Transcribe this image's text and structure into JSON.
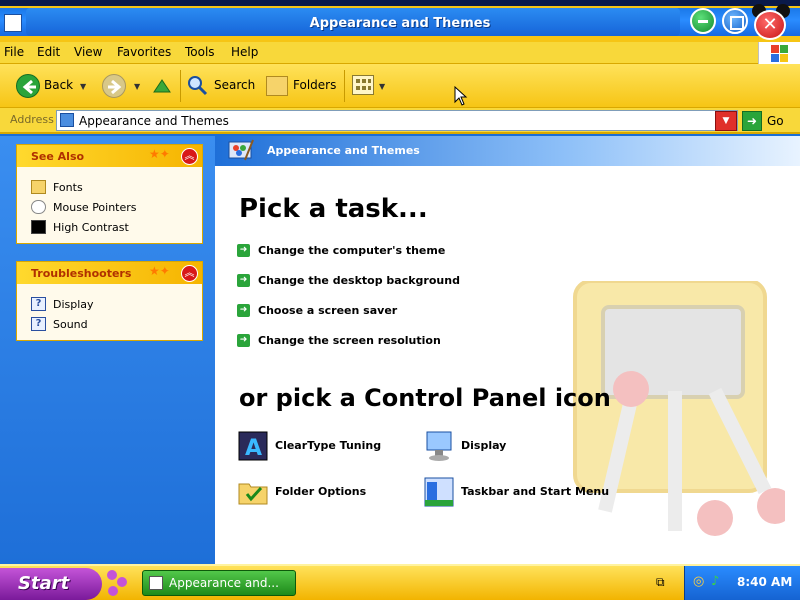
{
  "window": {
    "title": "Appearance and Themes"
  },
  "menubar": {
    "items": [
      "File",
      "Edit",
      "View",
      "Favorites",
      "Tools",
      "Help"
    ]
  },
  "toolbar": {
    "back_label": "Back",
    "search_label": "Search",
    "folders_label": "Folders"
  },
  "address": {
    "label": "Address",
    "value": "Appearance and Themes",
    "go_label": "Go"
  },
  "left_pane": {
    "see_also": {
      "title": "See Also",
      "items": [
        {
          "label": "Fonts",
          "icon": "folder-icon"
        },
        {
          "label": "Mouse Pointers",
          "icon": "mouse-icon"
        },
        {
          "label": "High Contrast",
          "icon": "contrast-icon"
        }
      ]
    },
    "troubleshooters": {
      "title": "Troubleshooters",
      "items": [
        {
          "label": "Display",
          "icon": "help-icon"
        },
        {
          "label": "Sound",
          "icon": "help-icon"
        }
      ]
    }
  },
  "main": {
    "header_title": "Appearance and Themes",
    "pick_task": "Pick a task...",
    "tasks": [
      "Change the computer's theme",
      "Change the desktop background",
      "Choose a screen saver",
      "Change the screen resolution"
    ],
    "pick_icon": "or pick a Control Panel icon",
    "icons": [
      {
        "label": "ClearType Tuning",
        "icon": "cleartype-icon"
      },
      {
        "label": "Display",
        "icon": "display-icon"
      },
      {
        "label": "Folder Options",
        "icon": "folder-options-icon"
      },
      {
        "label": "Taskbar and Start Menu",
        "icon": "taskbar-icon"
      }
    ]
  },
  "taskbar": {
    "start_label": "Start",
    "window_button_label": "Appearance and...",
    "clock": "8:40 AM"
  },
  "colors": {
    "accent_yellow": "#f6c515",
    "title_blue": "#1769e0",
    "close_red": "#d81818",
    "start_purple": "#7a1a9a",
    "task_green": "#1e8a1a"
  }
}
